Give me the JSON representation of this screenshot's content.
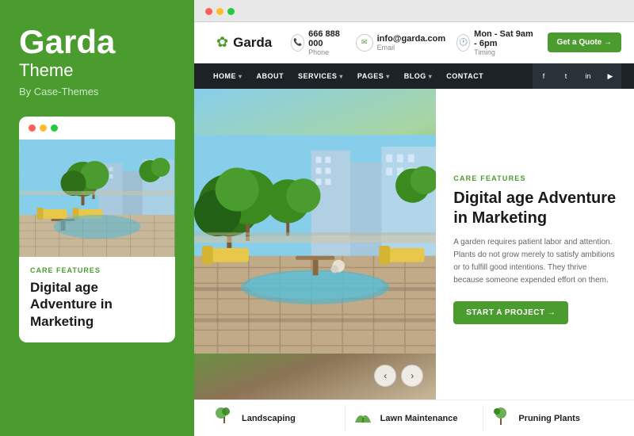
{
  "sidebar": {
    "title": "Garda",
    "subtitle": "Theme",
    "by": "By Case-Themes",
    "card": {
      "care_label": "CARE FEATURES",
      "title": "Digital age Adventure in",
      "title_cont": "Marketing"
    }
  },
  "browser": {
    "dots": [
      "red",
      "yellow",
      "green"
    ]
  },
  "site": {
    "logo": {
      "icon": "✿",
      "name": "Garda"
    },
    "header": {
      "phone_number": "666 888 000",
      "phone_label": "Phone",
      "email_address": "info@garda.com",
      "email_label": "Email",
      "timing": "Mon - Sat 9am - 6pm",
      "timing_label": "Timing",
      "cta": "Get a Quote →"
    },
    "nav": {
      "items": [
        {
          "label": "HOME",
          "has_dropdown": true
        },
        {
          "label": "ABOUT",
          "has_dropdown": false
        },
        {
          "label": "SERVICES",
          "has_dropdown": true
        },
        {
          "label": "PAGES",
          "has_dropdown": true
        },
        {
          "label": "BLOG",
          "has_dropdown": true
        },
        {
          "label": "CONTACT",
          "has_dropdown": false
        }
      ],
      "social": [
        "f",
        "t",
        "in",
        "yt"
      ]
    },
    "hero": {
      "care_label": "CARE FEATURES",
      "title": "Digital age Adventure in Marketing",
      "description": "A garden requires patient labor and attention. Plants do not grow merely to satisfy ambitions or to fulfill good intentions. They thrive because someone expended effort on them.",
      "cta": "START A PROJECT →"
    },
    "services": [
      {
        "icon": "🌿",
        "name": "Landscaping"
      },
      {
        "icon": "✂️",
        "name": "Lawn Maintenance"
      },
      {
        "icon": "🌱",
        "name": "Pruning Plants"
      }
    ]
  }
}
